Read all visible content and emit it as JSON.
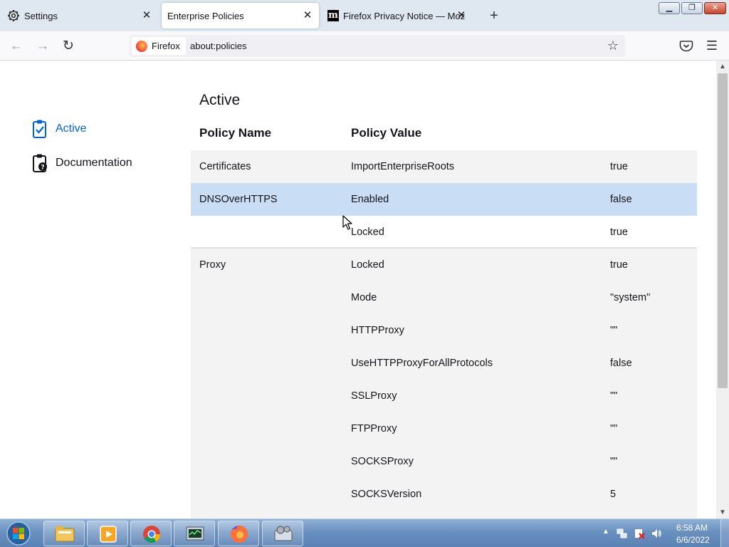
{
  "tabs": [
    {
      "title": "Settings",
      "icon": "gear-icon"
    },
    {
      "title": "Enterprise Policies",
      "active": true
    },
    {
      "title": "Firefox Privacy Notice — Mozilla",
      "icon": "mozilla-icon"
    }
  ],
  "navbar": {
    "identity_label": "Firefox",
    "url": "about:policies"
  },
  "sidebar": {
    "items": [
      {
        "label": "Active",
        "icon": "clipboard-check-icon",
        "selected": true
      },
      {
        "label": "Documentation",
        "icon": "clipboard-question-icon"
      }
    ]
  },
  "main": {
    "title": "Active",
    "columns": {
      "name": "Policy Name",
      "value": "Policy Value"
    },
    "rows": [
      {
        "name": "Certificates",
        "key": "ImportEnterpriseRoots",
        "value": "true"
      },
      {
        "name": "DNSOverHTTPS",
        "key": "Enabled",
        "value": "false"
      },
      {
        "name": "",
        "key": "Locked",
        "value": "true"
      },
      {
        "name": "Proxy",
        "key": "Locked",
        "value": "true"
      },
      {
        "name": "",
        "key": "Mode",
        "value": "\"system\""
      },
      {
        "name": "",
        "key": "HTTPProxy",
        "value": "\"\""
      },
      {
        "name": "",
        "key": "UseHTTPProxyForAllProtocols",
        "value": "false"
      },
      {
        "name": "",
        "key": "SSLProxy",
        "value": "\"\""
      },
      {
        "name": "",
        "key": "FTPProxy",
        "value": "\"\""
      },
      {
        "name": "",
        "key": "SOCKSProxy",
        "value": "\"\""
      },
      {
        "name": "",
        "key": "SOCKSVersion",
        "value": "5"
      }
    ]
  },
  "taskbar": {
    "apps": [
      "explorer-icon",
      "media-player-icon",
      "chrome-icon",
      "task-manager-icon",
      "firefox-icon",
      "control-panel-icon"
    ],
    "clock_time": "6:58 AM",
    "clock_date": "6/6/2022"
  },
  "colors": {
    "accent": "#0061e0",
    "row_selected": "#c9ddf4",
    "row_shade": "#f3f3f3"
  }
}
